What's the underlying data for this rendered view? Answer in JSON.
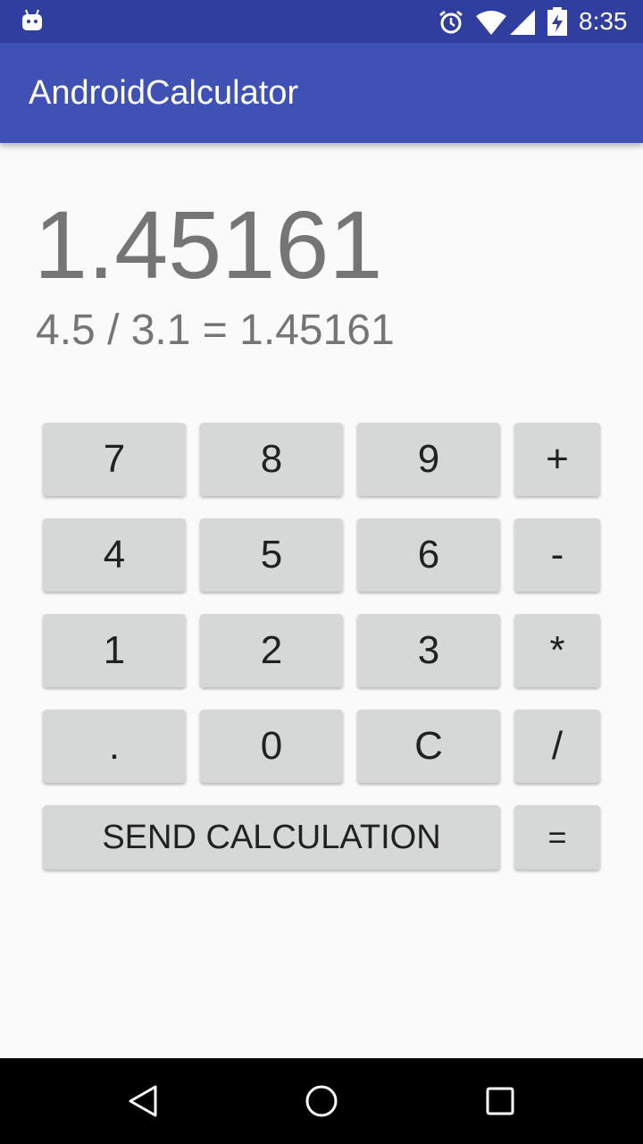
{
  "status_bar": {
    "time": "8:35",
    "icons": [
      "android-icon",
      "alarm-icon",
      "wifi-icon",
      "signal-icon",
      "battery-charging-icon"
    ]
  },
  "app_bar": {
    "title": "AndroidCalculator"
  },
  "display": {
    "result": "1.45161",
    "expression": "4.5 / 3.1 = 1.45161"
  },
  "keypad": {
    "row1": [
      "7",
      "8",
      "9",
      "+"
    ],
    "row2": [
      "4",
      "5",
      "6",
      "-"
    ],
    "row3": [
      "1",
      "2",
      "3",
      "*"
    ],
    "row4": [
      ".",
      "0",
      "C",
      "/"
    ],
    "send_label": "SEND CALCULATION",
    "equals_label": "="
  },
  "nav_bar": {
    "icons": [
      "back-icon",
      "home-icon",
      "recents-icon"
    ]
  },
  "colors": {
    "status_bar": "#303f9f",
    "app_bar": "#3f51b5",
    "background": "#fafafa",
    "key": "#d6d7d7",
    "display_text": "#757575"
  }
}
